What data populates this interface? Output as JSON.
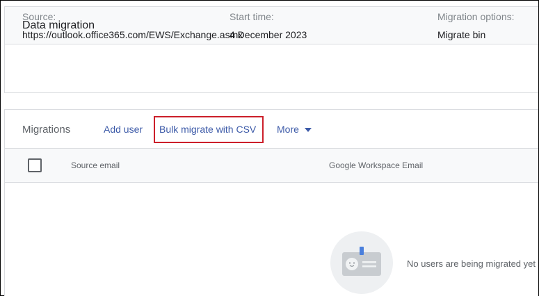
{
  "data_migration": {
    "title": "Data migration",
    "source_label": "Source:",
    "source_value": "https://outlook.office365.com/EWS/Exchange.asmx",
    "start_label": "Start time:",
    "start_value": "4 December 2023",
    "options_label": "Migration options:",
    "options_value": "Migrate bin"
  },
  "migrations": {
    "title": "Migrations",
    "add_user": "Add user",
    "bulk_migrate": "Bulk migrate with CSV",
    "more": "More",
    "columns": [
      "Source email",
      "Google Workspace Email"
    ],
    "empty_text": "No users are being migrated yet"
  },
  "colors": {
    "accent": "#3c5aa8",
    "highlight": "#cc1f2a"
  },
  "icons": {
    "more": "chevron-down-icon",
    "empty": "id-card-icon"
  }
}
